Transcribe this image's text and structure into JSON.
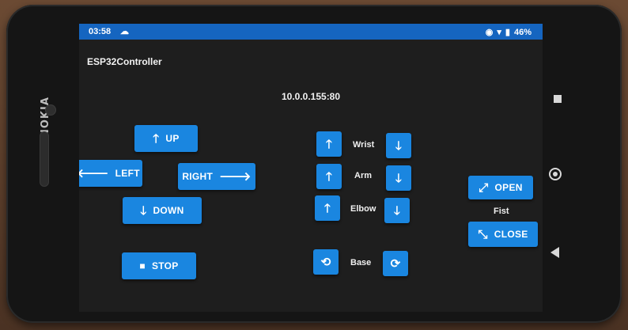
{
  "device": {
    "brand": "NOKIA"
  },
  "statusbar": {
    "time": "03:58",
    "cloud_icon": "cloud-icon",
    "battery": "46%"
  },
  "app": {
    "title": "ESP32Controller",
    "ip": "10.0.0.155:80"
  },
  "movement": {
    "up": "UP",
    "left": "LEFT",
    "right": "RIGHT",
    "down": "DOWN",
    "stop": "STOP"
  },
  "joints": {
    "wrist": "Wrist",
    "arm": "Arm",
    "elbow": "Elbow",
    "base": "Base"
  },
  "fist": {
    "open": "OPEN",
    "label": "Fist",
    "close": "CLOSE"
  },
  "colors": {
    "button": "#1a86e0",
    "statusbar": "#1565c0",
    "screen_bg": "#1e1e1e"
  },
  "icons": {
    "up": "arrow-up-icon",
    "down": "arrow-down-icon",
    "left": "arrow-left-icon",
    "right": "arrow-right-icon",
    "stop": "stop-icon",
    "rotate": "rotate-icon",
    "expand": "expand-icon",
    "collapse": "collapse-icon"
  }
}
